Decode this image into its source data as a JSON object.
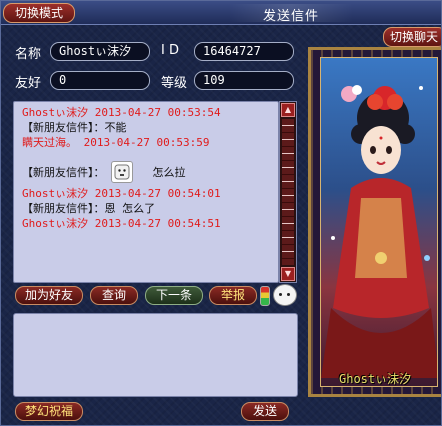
{
  "title_bar": {
    "mode_button": "切换模式",
    "title": "发送信件",
    "switch_chat_button": "切换聊天"
  },
  "info": {
    "name_label": "名称",
    "name_value": "Ghostぃ沫汐",
    "id_label": "I D",
    "id_value": "16464727",
    "friendship_label": "友好",
    "friendship_value": "0",
    "level_label": "等级",
    "level_value": "109"
  },
  "chat": {
    "lines": [
      {
        "text": "Ghostぃ沫汐 2013-04-27 00:53:54",
        "color": "red"
      },
      {
        "text": "【新朋友信件】：不能",
        "color": "black"
      },
      {
        "text": "瞒天过海。 2013-04-27 00:53:59",
        "color": "red"
      },
      {
        "text": "【新朋友信件】：",
        "color": "black"
      },
      {
        "text": "怎么拉",
        "color": "black"
      },
      {
        "text": "Ghostぃ沫汐 2013-04-27 00:54:01",
        "color": "red"
      },
      {
        "text": "【新朋友信件】：恩 怎么了",
        "color": "black"
      },
      {
        "text": "Ghostぃ沫汐 2013-04-27 00:54:51",
        "color": "red"
      }
    ]
  },
  "actions": {
    "add_friend": "加为好友",
    "query": "查询",
    "next": "下一条",
    "report": "举报"
  },
  "bottom": {
    "blessing": "梦幻祝福",
    "send": "发送"
  },
  "portrait": {
    "caption": "Ghostぃ沫汐"
  },
  "colors": {
    "chat_bg": "#c9cce8",
    "timestamp_red": "#e01b1b",
    "button_red": "#8a2a24",
    "frame_gold": "#a98441"
  }
}
